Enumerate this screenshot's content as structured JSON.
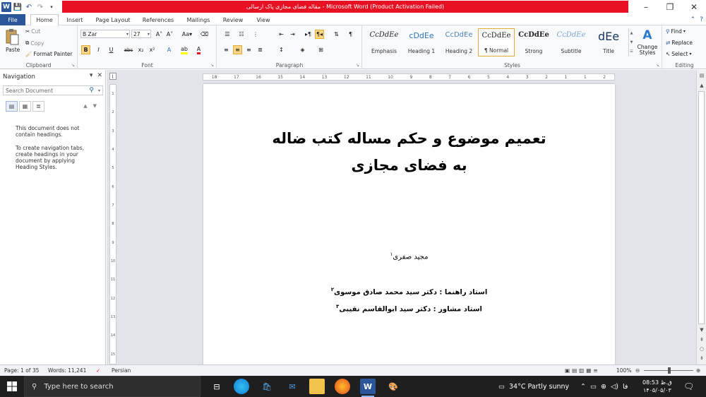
{
  "window": {
    "title": "مقاله فضای مجازی پاک ارسالی  -  Microsoft Word (Product Activation Failed)",
    "minimize": "–",
    "restore": "❐",
    "close": "✕"
  },
  "tabs": [
    {
      "label": "File"
    },
    {
      "label": "Home"
    },
    {
      "label": "Insert"
    },
    {
      "label": "Page Layout"
    },
    {
      "label": "References"
    },
    {
      "label": "Mailings"
    },
    {
      "label": "Review"
    },
    {
      "label": "View"
    }
  ],
  "clipboard": {
    "paste": "Paste",
    "cut": "Cut",
    "copy": "Copy",
    "format_painter": "Format Painter",
    "label": "Clipboard"
  },
  "font": {
    "name": "B Zar",
    "size": "27",
    "grow": "A˄",
    "shrink": "A˅",
    "change_case": "Aa▾",
    "bold": "B",
    "italic": "I",
    "underline": "U",
    "strikethrough": "abc",
    "subscript": "x₂",
    "superscript": "x²",
    "label": "Font"
  },
  "paragraph": {
    "label": "Paragraph",
    "show_marks": "¶"
  },
  "styles": {
    "items": [
      {
        "sample": "CcDdEe",
        "name": "Emphasis"
      },
      {
        "sample": "cDdEe",
        "name": "Heading 1"
      },
      {
        "sample": "CcDdEe",
        "name": "Heading 2"
      },
      {
        "sample": "CcDdEe",
        "name": "¶ Normal"
      },
      {
        "sample": "CcDdEe",
        "name": "Strong"
      },
      {
        "sample": "CcDdEe",
        "name": "Subtitle"
      },
      {
        "sample": "dEe",
        "name": "Title"
      }
    ],
    "change_styles": "Change Styles",
    "label": "Styles"
  },
  "editing": {
    "find": "Find",
    "replace": "Replace",
    "select": "Select",
    "label": "Editing"
  },
  "navigation": {
    "title": "Navigation",
    "search_placeholder": "Search Document",
    "message1": "This document does not contain headings.",
    "message2": "To create navigation tabs, create headings in your document by applying Heading Styles."
  },
  "ruler": {
    "h_ticks": [
      "18",
      "17",
      "16",
      "15",
      "14",
      "13",
      "12",
      "11",
      "10",
      "9",
      "8",
      "7",
      "6",
      "5",
      "4",
      "3",
      "2",
      "1",
      "1",
      "2"
    ],
    "v_ticks": [
      "1",
      "2",
      "3",
      "4",
      "5",
      "6",
      "7",
      "8",
      "9",
      "10",
      "11",
      "12",
      "13",
      "14",
      "15"
    ]
  },
  "document": {
    "title_line1": "تعمیم موضوع و حکم مساله کتب ضاله",
    "title_line2": "به فضای مجازی",
    "author": "مجید صفری",
    "author_note": "۱",
    "advisor1": "استاد راهنما : دکتر سید محمد صادق موسوی",
    "advisor1_note": "۲",
    "advisor2": "استاد مشاور : دکتر سید ابوالقاسم نقیبی",
    "advisor2_note": "۳"
  },
  "status": {
    "page": "Page: 1 of 35",
    "words": "Words: 11,241",
    "language": "Persian",
    "zoom": "100%"
  },
  "taskbar": {
    "search_placeholder": "Type here to search",
    "weather": "34°C  Partly sunny",
    "lang": "فا",
    "time": "08:53 ق.ظ",
    "date": "۱۴۰۵/۰۵/۰۳"
  }
}
